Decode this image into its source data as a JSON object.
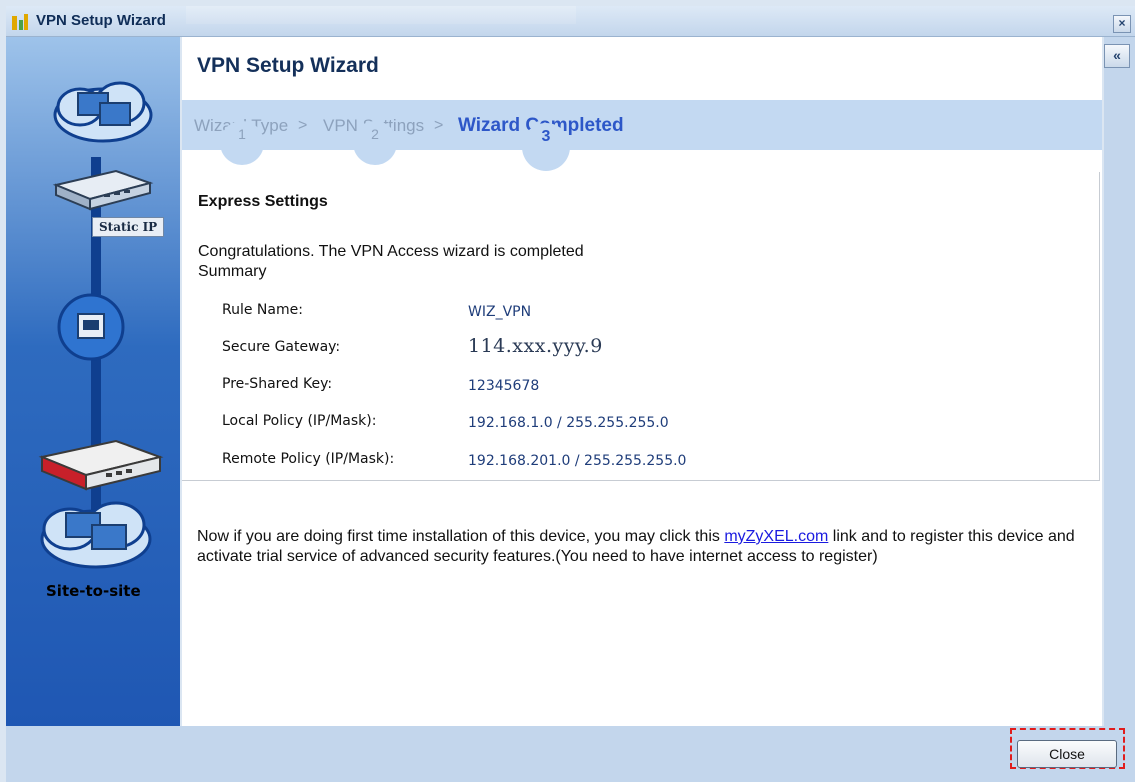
{
  "window": {
    "title": "VPN Setup Wizard",
    "close_icon": "close-icon"
  },
  "sidebar": {
    "static_ip_label": "Static IP",
    "site_label": "Site-to-site"
  },
  "main": {
    "title": "VPN Setup Wizard",
    "steps": [
      {
        "label": "Wizard Type",
        "number": "1"
      },
      {
        "label": "VPN Settings",
        "number": "2"
      },
      {
        "label": "Wizard Completed",
        "number": "3",
        "active": true
      }
    ],
    "step_separator": ">",
    "express": {
      "title": "Express Settings",
      "congrats_line1": "Congratulations. The VPN Access wizard is completed",
      "congrats_line2": "Summary",
      "rows": [
        {
          "label": "Rule Name:",
          "value": "WIZ_VPN"
        },
        {
          "label": "Secure Gateway:",
          "value": "114.xxx.yyy.9"
        },
        {
          "label": "Pre-Shared Key:",
          "value": "12345678"
        },
        {
          "label": "Local Policy (IP/Mask):",
          "value": "192.168.1.0 / 255.255.255.0"
        },
        {
          "label": "Remote Policy (IP/Mask):",
          "value": "192.168.201.0 / 255.255.255.0"
        }
      ]
    },
    "note_before": "Now if you are doing first time installation of this device, you may click this ",
    "note_link": "myZyXEL.com",
    "note_after": " link and to register this device and activate trial service of advanced security features.(You need to have internet access to register)"
  },
  "footer": {
    "close_label": "Close"
  },
  "colors": {
    "accent": "#2d57c8",
    "step_bar": "#c3d9f2",
    "sidebar_dark": "#1f57b3",
    "highlight_dash": "#e01c1c"
  }
}
